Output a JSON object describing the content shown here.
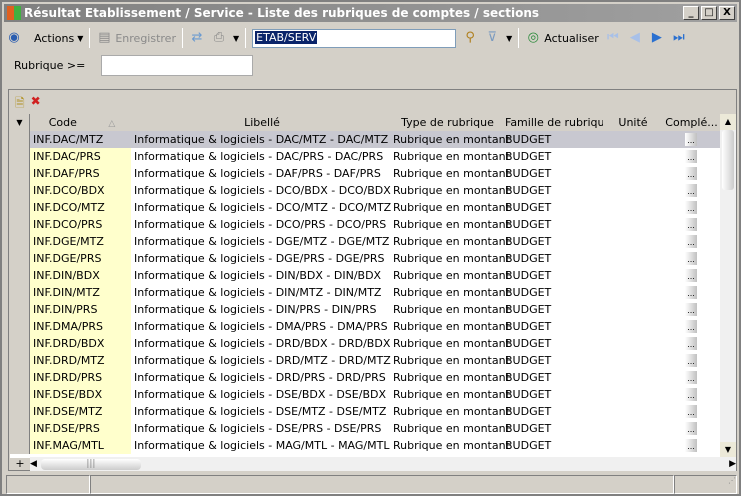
{
  "window": {
    "title": "Résultat Etablissement / Service -  Liste des rubriques de comptes / sections",
    "min": "_",
    "max": "□",
    "close": "X"
  },
  "toolbar": {
    "actions": "Actions",
    "save": "Enregistrer",
    "search_value": "ETAB/SERV",
    "refresh": "Actualiser"
  },
  "filter": {
    "label": "Rubrique >=",
    "value": ""
  },
  "grid": {
    "columns": [
      "Code",
      "Libellé",
      "Type de rubrique",
      "Famille de rubrique",
      "Unité",
      "Complé..."
    ],
    "rows": [
      [
        "INF.DAC/MTZ",
        "Informatique & logiciels - DAC/MTZ - DAC/MTZ",
        "Rubrique en montant",
        "BUDGET",
        "",
        "..."
      ],
      [
        "INF.DAC/PRS",
        "Informatique & logiciels - DAC/PRS - DAC/PRS",
        "Rubrique en montant",
        "BUDGET",
        "",
        "..."
      ],
      [
        "INF.DAF/PRS",
        "Informatique & logiciels - DAF/PRS - DAF/PRS",
        "Rubrique en montant",
        "BUDGET",
        "",
        "..."
      ],
      [
        "INF.DCO/BDX",
        "Informatique & logiciels - DCO/BDX - DCO/BDX",
        "Rubrique en montant",
        "BUDGET",
        "",
        "..."
      ],
      [
        "INF.DCO/MTZ",
        "Informatique & logiciels - DCO/MTZ - DCO/MTZ",
        "Rubrique en montant",
        "BUDGET",
        "",
        "..."
      ],
      [
        "INF.DCO/PRS",
        "Informatique & logiciels - DCO/PRS - DCO/PRS",
        "Rubrique en montant",
        "BUDGET",
        "",
        "..."
      ],
      [
        "INF.DGE/MTZ",
        "Informatique & logiciels - DGE/MTZ - DGE/MTZ",
        "Rubrique en montant",
        "BUDGET",
        "",
        "..."
      ],
      [
        "INF.DGE/PRS",
        "Informatique & logiciels - DGE/PRS - DGE/PRS",
        "Rubrique en montant",
        "BUDGET",
        "",
        "..."
      ],
      [
        "INF.DIN/BDX",
        "Informatique & logiciels - DIN/BDX - DIN/BDX",
        "Rubrique en montant",
        "BUDGET",
        "",
        "..."
      ],
      [
        "INF.DIN/MTZ",
        "Informatique & logiciels - DIN/MTZ - DIN/MTZ",
        "Rubrique en montant",
        "BUDGET",
        "",
        "..."
      ],
      [
        "INF.DIN/PRS",
        "Informatique & logiciels - DIN/PRS - DIN/PRS",
        "Rubrique en montant",
        "BUDGET",
        "",
        "..."
      ],
      [
        "INF.DMA/PRS",
        "Informatique & logiciels - DMA/PRS - DMA/PRS",
        "Rubrique en montant",
        "BUDGET",
        "",
        "..."
      ],
      [
        "INF.DRD/BDX",
        "Informatique & logiciels - DRD/BDX - DRD/BDX",
        "Rubrique en montant",
        "BUDGET",
        "",
        "..."
      ],
      [
        "INF.DRD/MTZ",
        "Informatique & logiciels - DRD/MTZ - DRD/MTZ",
        "Rubrique en montant",
        "BUDGET",
        "",
        "..."
      ],
      [
        "INF.DRD/PRS",
        "Informatique & logiciels - DRD/PRS - DRD/PRS",
        "Rubrique en montant",
        "BUDGET",
        "",
        "..."
      ],
      [
        "INF.DSE/BDX",
        "Informatique & logiciels - DSE/BDX - DSE/BDX",
        "Rubrique en montant",
        "BUDGET",
        "",
        "..."
      ],
      [
        "INF.DSE/MTZ",
        "Informatique & logiciels - DSE/MTZ - DSE/MTZ",
        "Rubrique en montant",
        "BUDGET",
        "",
        "..."
      ],
      [
        "INF.DSE/PRS",
        "Informatique & logiciels - DSE/PRS - DSE/PRS",
        "Rubrique en montant",
        "BUDGET",
        "",
        "..."
      ],
      [
        "INF.MAG/MTL",
        "Informatique & logiciels - MAG/MTL - MAG/MTL",
        "Rubrique en montant",
        "BUDGET",
        "",
        "..."
      ]
    ]
  },
  "colors": {
    "code_column": "#ffffcc",
    "selected_row": "#c8c8d0"
  }
}
